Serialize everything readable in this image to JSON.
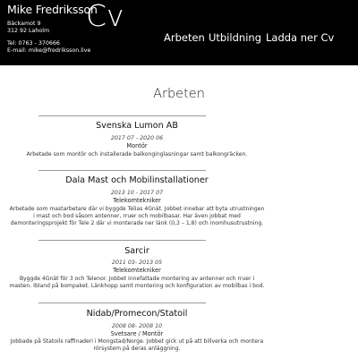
{
  "header": {
    "name": "Mike Fredriksson",
    "cv_label": "Cv",
    "address_line1": "Bäckamot 9",
    "address_line2": "312 92 Laholm",
    "phone": "Tel: 0763 - 370666",
    "email": "E-mail: mike@fredriksson.live"
  },
  "nav": {
    "items": [
      {
        "label": "Arbeten"
      },
      {
        "label": "Utbildning"
      },
      {
        "label": "Ladda ner Cv"
      }
    ]
  },
  "main": {
    "section_title": "Arbeten",
    "jobs": [
      {
        "company": "Svenska Lumon AB",
        "dates": "2017 07 - 2020 06",
        "role": "Montör",
        "description": "Arbetade som montör och installerade balkonginglasningar samt balkongräcken."
      },
      {
        "company": "Dala Mast och Mobilinstallationer",
        "dates": "2013 10 - 2017 07",
        "role": "Telekomtekniker",
        "description": "Arbetade som mastarbetare där vi byggde Telias 4Gnät. Jobbet innebar att byta utrustningen i mast och bod såsom antenner, rruer och mobilbasar. Har även jobbat med demonteringsprojekt för Tele 2 där vi monterade ner länk (0,3 – 1,8) och inomhusutrustning."
      },
      {
        "company": "Sarcir",
        "dates": "2011 03- 2013 05",
        "role": "Telekomtekniker",
        "description": "Byggde 4Gnät för 3 och Telenor. Jobbet innefattade montering av antenner och rruer i masten. Ibland på bompaket. Länkhopp samt montering och konfiguration av mobilbas i bod."
      },
      {
        "company": "Nidab/Promecon/Statoil",
        "dates": "2008 08- 2008 10",
        "role": "Svetsare / Montör",
        "description": "Jobbade på Statoils raffinaderi i Mongstad/Norge. Jobbet gick ut på att billverka och montera rörsystem på deras anläggning."
      }
    ]
  }
}
